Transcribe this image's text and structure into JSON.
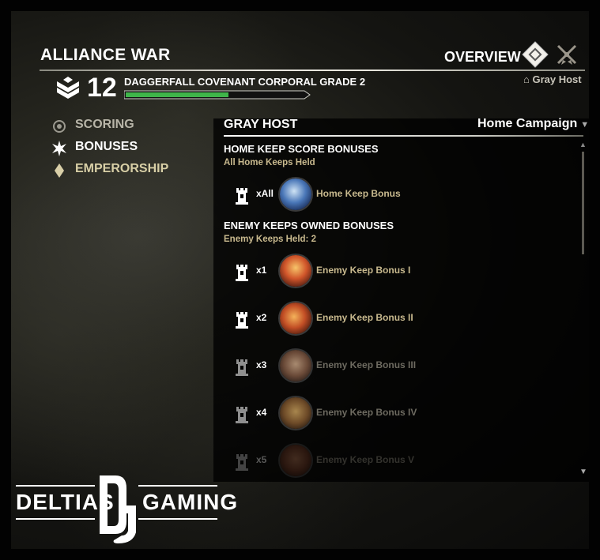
{
  "header": {
    "title": "ALLIANCE WAR",
    "overview_label": "OVERVIEW",
    "campaign_home": "Gray Host"
  },
  "rank": {
    "number": "12",
    "label": "DAGGERFALL COVENANT CORPORAL GRADE 2",
    "progress": 0.57
  },
  "nav": {
    "items": [
      {
        "label": "SCORING",
        "active": false
      },
      {
        "label": "BONUSES",
        "active": true
      },
      {
        "label": "EMPERORSHIP",
        "active": false
      }
    ]
  },
  "section": {
    "title": "GRAY HOST",
    "campaign_select": "Home Campaign"
  },
  "home_keep": {
    "heading": "HOME KEEP SCORE BONUSES",
    "sub": "All Home Keeps Held",
    "rows": [
      {
        "mult": "xAll",
        "name": "Home Keep Bonus",
        "icon": "home-keep-bonus-icon"
      }
    ]
  },
  "enemy_keeps": {
    "heading": "ENEMY KEEPS OWNED BONUSES",
    "sub": "Enemy Keeps Held: 2",
    "rows": [
      {
        "mult": "x1",
        "name": "Enemy Keep Bonus I",
        "icon": "enemy-keep-bonus-1-icon",
        "active": true
      },
      {
        "mult": "x2",
        "name": "Enemy Keep Bonus II",
        "icon": "enemy-keep-bonus-2-icon",
        "active": true
      },
      {
        "mult": "x3",
        "name": "Enemy Keep Bonus III",
        "icon": "enemy-keep-bonus-3-icon",
        "active": false
      },
      {
        "mult": "x4",
        "name": "Enemy Keep Bonus IV",
        "icon": "enemy-keep-bonus-4-icon",
        "active": false
      },
      {
        "mult": "x5",
        "name": "Enemy Keep Bonus V",
        "icon": "enemy-keep-bonus-5-icon",
        "active": false
      }
    ]
  },
  "watermark": {
    "left": "DELTIAS",
    "right": "GAMING",
    "monogram": "DG"
  },
  "colors": {
    "xp_green": "#3fb54a",
    "label_gold": "#c8b98e"
  }
}
